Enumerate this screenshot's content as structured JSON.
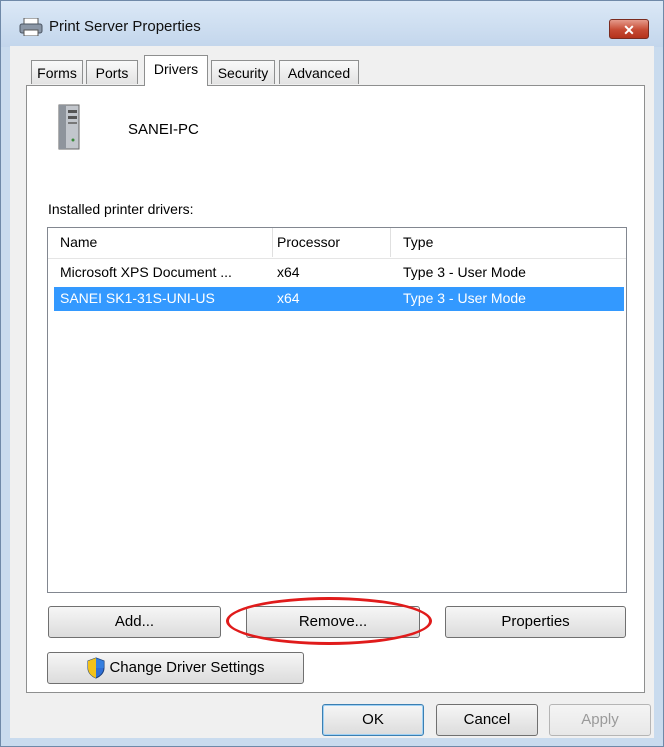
{
  "window": {
    "title": "Print Server Properties",
    "close_glyph": "✕"
  },
  "tabs": [
    {
      "label": "Forms",
      "active": false
    },
    {
      "label": "Ports",
      "active": false
    },
    {
      "label": "Drivers",
      "active": true
    },
    {
      "label": "Security",
      "active": false
    },
    {
      "label": "Advanced",
      "active": false
    }
  ],
  "server": {
    "name": "SANEI-PC",
    "icon": "server-tower-icon"
  },
  "drivers": {
    "label": "Installed printer drivers:",
    "columns": [
      "Name",
      "Processor",
      "Type"
    ],
    "rows": [
      {
        "name": "Microsoft XPS Document ...",
        "processor": "x64",
        "type": "Type 3 - User Mode",
        "selected": false
      },
      {
        "name": "SANEI SK1-31S-UNI-US",
        "processor": "x64",
        "type": "Type 3 - User Mode",
        "selected": true
      }
    ]
  },
  "buttons": {
    "add": "Add...",
    "remove": "Remove...",
    "properties": "Properties",
    "change_driver_settings": "Change Driver Settings",
    "ok": "OK",
    "cancel": "Cancel",
    "apply": "Apply"
  },
  "colors": {
    "selection": "#3399ff",
    "highlight_ring": "#e01b1b",
    "close_button": "#c64a33"
  }
}
